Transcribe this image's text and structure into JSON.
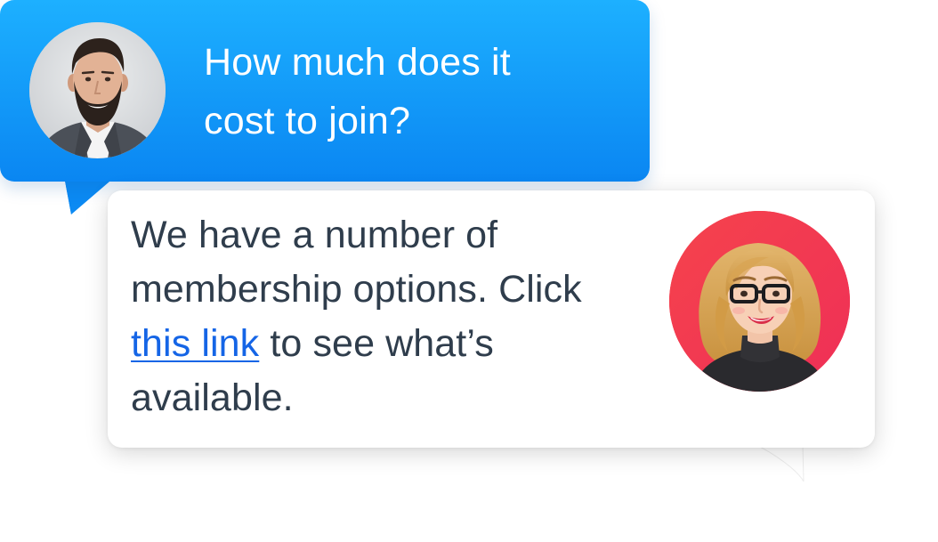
{
  "user_message": {
    "line1": "How much does it",
    "line2": "cost to join?",
    "bubble_color": "#0a86f2"
  },
  "agent_message": {
    "text_before_link": "We have a number of membership options. Click",
    "link_text": "this link",
    "text_after_link": "to see what’s available.",
    "text_color": "#2f3d4c",
    "link_color": "#1565e6"
  },
  "user_avatar": {
    "icon": "user-photo-avatar"
  },
  "agent_avatar": {
    "icon": "agent-cartoon-avatar",
    "background": "#f23a4a"
  }
}
